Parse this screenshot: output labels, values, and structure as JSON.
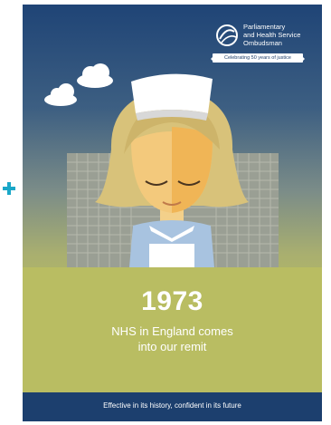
{
  "logo": {
    "org_name": "Parliamentary\nand Health Service\nOmbudsman",
    "ribbon": "Celebrating 50 years of justice"
  },
  "headline": {
    "year": "1973",
    "caption": "NHS in England comes\ninto our remit"
  },
  "footer": {
    "tagline": "Effective in its history, confident in its future"
  },
  "colors": {
    "accent_plus": "#1aa7c8",
    "footer_bg": "#1c3f6e",
    "sky_top": "#1f4476",
    "ground": "#c8ca5c"
  }
}
